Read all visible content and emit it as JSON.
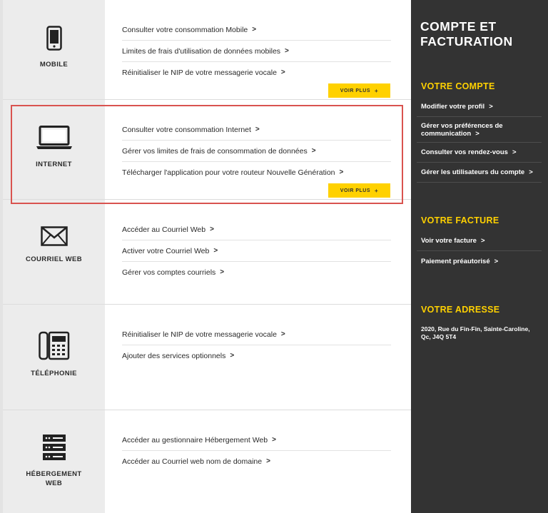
{
  "sections": [
    {
      "label": "MOBILE",
      "icon": "mobile-phone-icon",
      "links": [
        "Consulter votre consommation Mobile",
        "Limites de frais d'utilisation de données mobiles",
        "Réinitialiser le NIP de votre messagerie vocale"
      ],
      "more_label": "VOIR PLUS"
    },
    {
      "label": "INTERNET",
      "icon": "laptop-icon",
      "links": [
        "Consulter votre consommation Internet",
        "Gérer vos limites de frais de consommation de données",
        "Télécharger l'application pour votre routeur Nouvelle Génération"
      ],
      "more_label": "VOIR PLUS"
    },
    {
      "label": "COURRIEL WEB",
      "icon": "envelope-icon",
      "links": [
        "Accéder au Courriel Web",
        "Activer votre Courriel Web",
        "Gérer vos comptes courriels"
      ]
    },
    {
      "label": "TÉLÉPHONIE",
      "icon": "desk-phone-icon",
      "links": [
        "Réinitialiser le NIP de votre messagerie vocale",
        "Ajouter des services optionnels"
      ]
    },
    {
      "label_lines": [
        "HÉBERGEMENT",
        "WEB"
      ],
      "icon": "server-icon",
      "links": [
        "Accéder au gestionnaire Hébergement Web",
        "Accéder au Courriel web nom de domaine"
      ]
    }
  ],
  "sidebar": {
    "title_line1": "COMPTE ET",
    "title_line2": "FACTURATION",
    "account": {
      "heading": "VOTRE COMPTE",
      "items": [
        "Modifier votre profil",
        "Gérer vos préférences de communication",
        "Consulter vos rendez-vous",
        "Gérer les utilisateurs du compte"
      ]
    },
    "billing": {
      "heading": "VOTRE FACTURE",
      "items": [
        "Voir votre facture",
        "Paiement préautorisé"
      ]
    },
    "address": {
      "heading": "VOTRE ADRESSE",
      "text": "2020, Rue du Fin-Fin, Sainte-Caroline, Qc, J4Q 5T4"
    }
  },
  "colors": {
    "accent": "#ffd100",
    "sidebar_bg": "#333333",
    "icon_column_bg": "#ececec",
    "highlight": "#d9534f"
  }
}
